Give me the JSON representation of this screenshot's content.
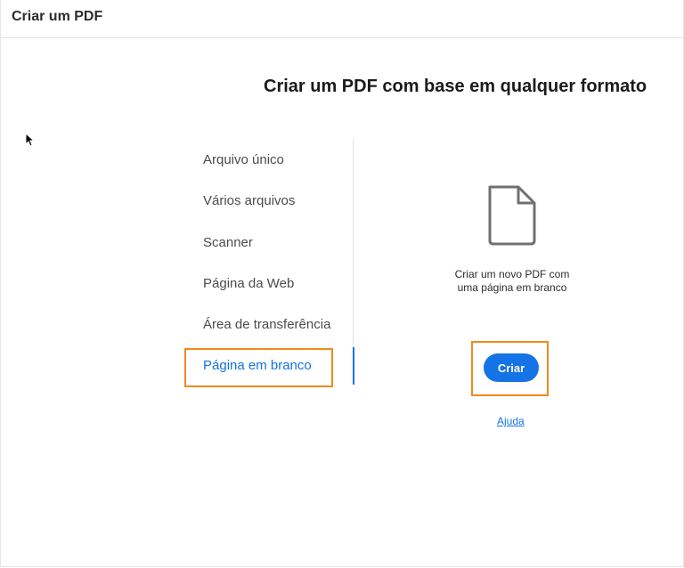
{
  "window": {
    "title": "Criar um PDF"
  },
  "main": {
    "headline": "Criar um PDF com base em qualquer formato"
  },
  "options": [
    {
      "label": "Arquivo único",
      "selected": false
    },
    {
      "label": "Vários arquivos",
      "selected": false
    },
    {
      "label": "Scanner",
      "selected": false
    },
    {
      "label": "Página da Web",
      "selected": false
    },
    {
      "label": "Área de transferência",
      "selected": false
    },
    {
      "label": "Página em branco",
      "selected": true
    }
  ],
  "detail": {
    "icon": "blank-document-icon",
    "description_line1": "Criar um novo PDF com",
    "description_line2": "uma página em branco",
    "create_label": "Criar",
    "help_label": "Ajuda"
  },
  "colors": {
    "accent": "#1473e6",
    "highlight": "#f08a1d"
  }
}
